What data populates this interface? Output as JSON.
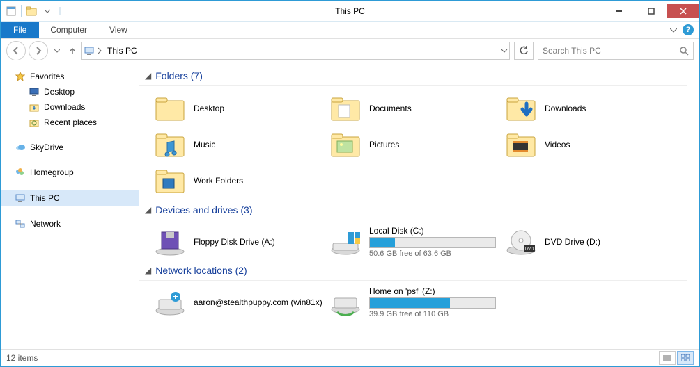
{
  "window": {
    "title": "This PC"
  },
  "ribbon": {
    "file": "File",
    "tabs": [
      "Computer",
      "View"
    ]
  },
  "address": {
    "location": "This PC"
  },
  "search": {
    "placeholder": "Search This PC"
  },
  "sidebar": {
    "favorites": {
      "label": "Favorites",
      "children": [
        "Desktop",
        "Downloads",
        "Recent places"
      ]
    },
    "skydrive": "SkyDrive",
    "homegroup": "Homegroup",
    "thispc": "This PC",
    "network": "Network"
  },
  "sections": {
    "folders": {
      "title": "Folders (7)",
      "items": [
        "Desktop",
        "Documents",
        "Downloads",
        "Music",
        "Pictures",
        "Videos",
        "Work Folders"
      ]
    },
    "drives": {
      "title": "Devices and drives (3)",
      "items": [
        {
          "label": "Floppy Disk Drive (A:)",
          "sub": "",
          "fill": 0
        },
        {
          "label": "Local Disk (C:)",
          "sub": "50.6 GB free of 63.6 GB",
          "fill": 20
        },
        {
          "label": "DVD Drive (D:)",
          "sub": "",
          "fill": 0
        }
      ]
    },
    "network": {
      "title": "Network locations (2)",
      "items": [
        {
          "label": "aaron@stealthpuppy.com (win81x)",
          "sub": "",
          "fill": 0
        },
        {
          "label": "Home on 'psf' (Z:)",
          "sub": "39.9 GB free of 110 GB",
          "fill": 64
        }
      ]
    }
  },
  "status": {
    "text": "12 items"
  }
}
